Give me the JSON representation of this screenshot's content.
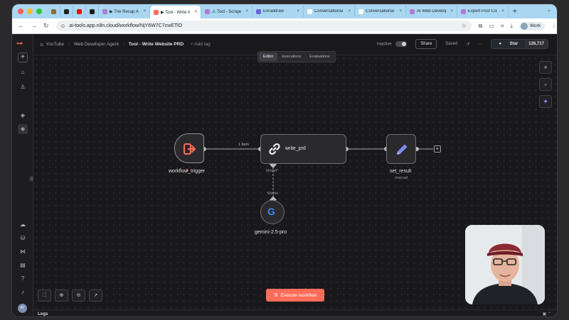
{
  "browser": {
    "tabs": [
      {
        "label": "",
        "fav_color": "#8a6d3b",
        "pinned": true
      },
      {
        "label": "",
        "fav_color": "#222222",
        "pinned": true
      },
      {
        "label": "",
        "fav_color": "#ff0000",
        "pinned": true
      },
      {
        "label": "",
        "fav_color": "#1a1a1a",
        "pinned": true
      },
      {
        "label": "▶ The Recap AI",
        "fav_color": "#b07ad6"
      },
      {
        "label": "▶ Tool - Write W",
        "fav_color": "#ff6d5a",
        "active": true
      },
      {
        "label": "⚠ Tool - Scrape",
        "fav_color": "#b07ad6"
      },
      {
        "label": "Excalidraw",
        "fav_color": "#6965db"
      },
      {
        "label": "Conversational",
        "fav_color": "#ffffff"
      },
      {
        "label": "Conversational",
        "fav_color": "#ffffff"
      },
      {
        "label": "AI Web Develop",
        "fav_color": "#b07ad6"
      },
      {
        "label": "Expert Post Con",
        "fav_color": "#b07ad6"
      }
    ],
    "url": "ai-tools.app.n8n.cloud/workflow/NjY6W7C7cwETlO",
    "profile": "Work"
  },
  "header": {
    "project": "YouTube",
    "folder": "Web Developer Agent",
    "title": "Tool - Write Website PRD",
    "add_tag": "+ Add tag",
    "status": "Inactive",
    "share": "Share",
    "saved": "Saved",
    "star": "Star",
    "star_count": "126,717"
  },
  "view_tabs": [
    "Editor",
    "Executions",
    "Evaluations"
  ],
  "workflow": {
    "trigger_name": "workflow_trigger",
    "agent_name": "write_prd",
    "edge_label": "1 item",
    "model_port": "Model*",
    "model_conn": "Model",
    "model_name": "gemini-2.5-pro",
    "set_name": "set_result",
    "set_sub": "manual"
  },
  "actions": {
    "execute": "Execute workflow"
  },
  "logs": {
    "label": "Logs"
  },
  "colors": {
    "accent": "#ff6d5a",
    "pencil": "#7b8cf0",
    "google_blue": "#4285f4"
  }
}
